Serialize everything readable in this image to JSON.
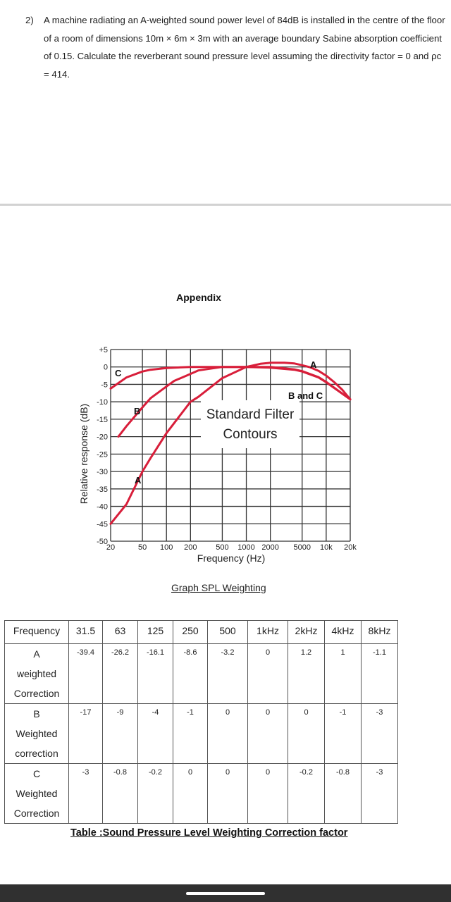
{
  "question": {
    "number": "2)",
    "text": "A machine radiating an A-weighted sound power level of 84dB is installed in the centre of the floor of a room of dimensions 10m × 6m × 3m with an average boundary Sabine absorption coefficient of 0.15. Calculate the reverberant sound pressure level assuming the directivity factor = 0 and ρc = 414."
  },
  "appendix": {
    "title": "Appendix"
  },
  "graph_caption": "Graph SPL Weighting",
  "chart_data": {
    "type": "line",
    "title": "Standard Filter Contours",
    "xlabel": "Frequency (Hz)",
    "ylabel": "Relative response (dB)",
    "x_scale": "log",
    "xlim": [
      20,
      20000
    ],
    "ylim": [
      -50,
      5
    ],
    "x_ticks": [
      20,
      50,
      100,
      200,
      500,
      1000,
      2000,
      5000,
      10000,
      20000
    ],
    "x_tick_labels": [
      "20",
      "50",
      "100",
      "200",
      "500",
      "1000",
      "2000",
      "5000",
      "10k",
      "20k"
    ],
    "y_ticks": [
      5,
      0,
      -5,
      -10,
      -15,
      -20,
      -25,
      -30,
      -35,
      -40,
      -45,
      -50
    ],
    "y_tick_labels": [
      "+5",
      "0",
      "-5",
      "-10",
      "-15",
      "-20",
      "-25",
      "-30",
      "-35",
      "-40",
      "-45",
      "-50"
    ],
    "grid": true,
    "series": [
      {
        "name": "A",
        "x": [
          20,
          31.5,
          50,
          63,
          100,
          125,
          200,
          250,
          500,
          1000,
          1500,
          2000,
          3000,
          4000,
          5000,
          6300,
          8000,
          10000,
          12500,
          16000,
          20000
        ],
        "values": [
          -45,
          -39.4,
          -30,
          -26.2,
          -19,
          -16.1,
          -10,
          -8.6,
          -3.2,
          0,
          0.9,
          1.2,
          1.2,
          1.0,
          0.5,
          -0.1,
          -1.1,
          -2.5,
          -4.3,
          -6.6,
          -9.3
        ]
      },
      {
        "name": "B",
        "x": [
          25,
          31.5,
          50,
          63,
          100,
          125,
          200,
          250,
          500,
          1000,
          2000,
          4000,
          5000,
          8000,
          10000,
          20000
        ],
        "values": [
          -20,
          -17,
          -11.6,
          -9,
          -5.6,
          -4,
          -2,
          -1,
          0,
          0,
          0,
          -0.7,
          -1.2,
          -2.9,
          -4.3,
          -9.3
        ]
      },
      {
        "name": "C",
        "x": [
          20,
          31.5,
          50,
          63,
          100,
          125,
          200,
          250,
          500,
          1000,
          2000,
          4000,
          5000,
          8000,
          10000,
          20000
        ],
        "values": [
          -6.2,
          -3,
          -1.3,
          -0.8,
          -0.3,
          -0.2,
          0,
          0,
          0,
          0,
          -0.2,
          -0.8,
          -1.3,
          -3,
          -4.4,
          -9.3
        ]
      }
    ],
    "annotations": [
      "C",
      "B",
      "A",
      "A",
      "B and C",
      "Standard Filter",
      "Contours"
    ],
    "line_color": "#d81e3a"
  },
  "table": {
    "caption": "Table :Sound Pressure Level Weighting Correction factor",
    "header_label": "Frequency",
    "frequencies": [
      "31.5",
      "63",
      "125",
      "250",
      "500",
      "1kHz",
      "2kHz",
      "4kHz",
      "8kHz"
    ],
    "rows": [
      {
        "label": [
          "A",
          "weighted",
          "Correction"
        ],
        "values": [
          "-39.4",
          "-26.2",
          "-16.1",
          "-8.6",
          "-3.2",
          "0",
          "1.2",
          "1",
          "-1.1"
        ]
      },
      {
        "label": [
          "B",
          "Weighted",
          "correction"
        ],
        "values": [
          "-17",
          "-9",
          "-4",
          "-1",
          "0",
          "0",
          "0",
          "-1",
          "-3"
        ]
      },
      {
        "label": [
          "C",
          "Weighted",
          "Correction"
        ],
        "values": [
          "-3",
          "-0.8",
          "-0.2",
          "0",
          "0",
          "0",
          "-0.2",
          "-0.8",
          "-3"
        ]
      }
    ]
  }
}
